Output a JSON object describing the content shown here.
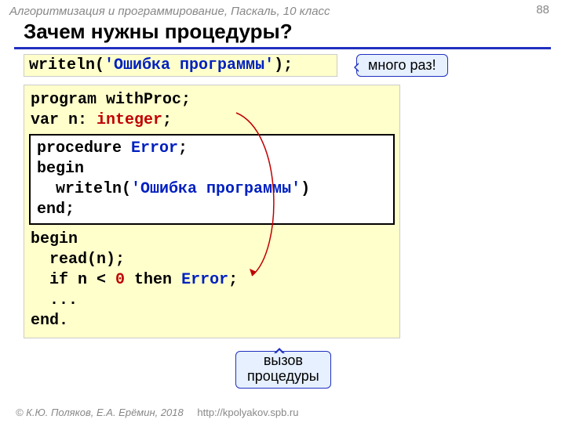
{
  "header": "Алгоритмизация и программирование, Паскаль, 10 класс",
  "pagenum": "88",
  "title": "Зачем нужны процедуры?",
  "line1": {
    "writeln": "writeln",
    "open": "(",
    "str": "'Ошибка программы'",
    "close": ");"
  },
  "callout1": "много раз!",
  "code": {
    "l1a": "program",
    "l1b": " withProc;",
    "l2a": "var",
    "l2b": " n: ",
    "l2c": "integer",
    "l2d": ";",
    "p1a": "procedure ",
    "p1b": "Error",
    "p1c": ";",
    "p2": "begin",
    "p3a": "  writeln(",
    "p3b": "'Ошибка программы'",
    "p3c": ")",
    "p4a": "end",
    "p4b": ";",
    "b1": "begin",
    "b2": "  read(n);",
    "b3a": "  if",
    "b3b": " n < ",
    "b3c": "0",
    "b3d": " then ",
    "b3e": "Error",
    "b3f": ";",
    "b4": "  ...",
    "b5a": "end",
    "b5b": "."
  },
  "callout2": {
    "l1": "вызов",
    "l2": "процедуры"
  },
  "footer": {
    "copy": "© К.Ю. Поляков, Е.А. Ерёмин, 2018",
    "url": "http://kpolyakov.spb.ru"
  }
}
